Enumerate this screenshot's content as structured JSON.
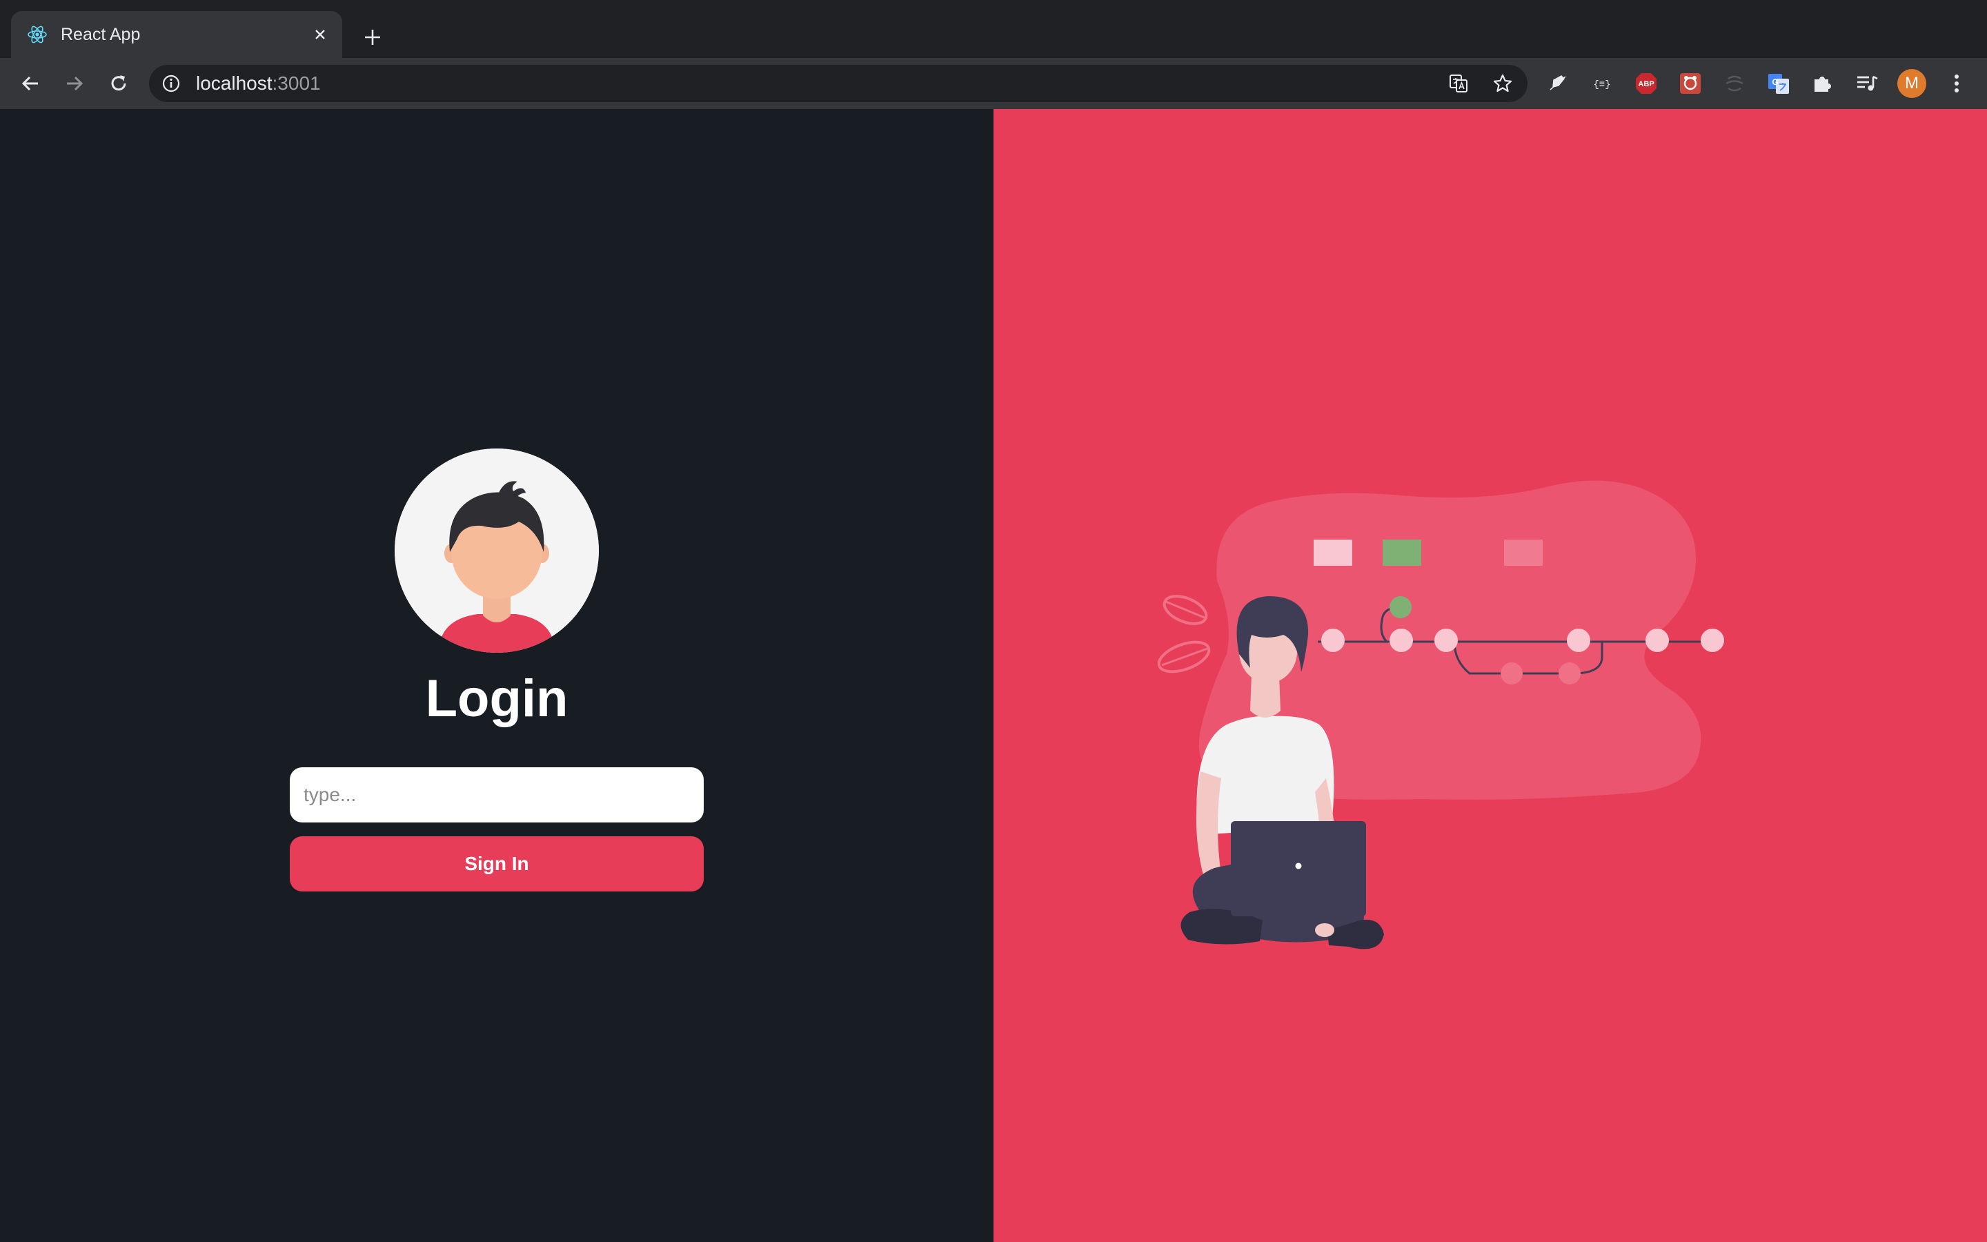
{
  "browser": {
    "tab_title": "React App",
    "url_host": "localhost",
    "url_port": ":3001",
    "profile_initial": "M",
    "extensions": [
      "translate-icon",
      "bookmark-star-icon",
      "extension-feather-icon",
      "extension-brackets-icon",
      "adblock-plus-icon",
      "extension-red-icon",
      "extension-gray-icon",
      "google-translate-icon",
      "puzzle-icon",
      "media-playlist-icon"
    ],
    "extension_labels": {
      "abp": "ABP",
      "brackets": "{≡}",
      "gtranslate": "G"
    }
  },
  "login": {
    "title": "Login",
    "input_placeholder": "type...",
    "input_value": "",
    "button_label": "Sign In"
  },
  "colors": {
    "left_background": "#181d24",
    "right_background": "#e83d58",
    "accent": "#e83d58"
  }
}
